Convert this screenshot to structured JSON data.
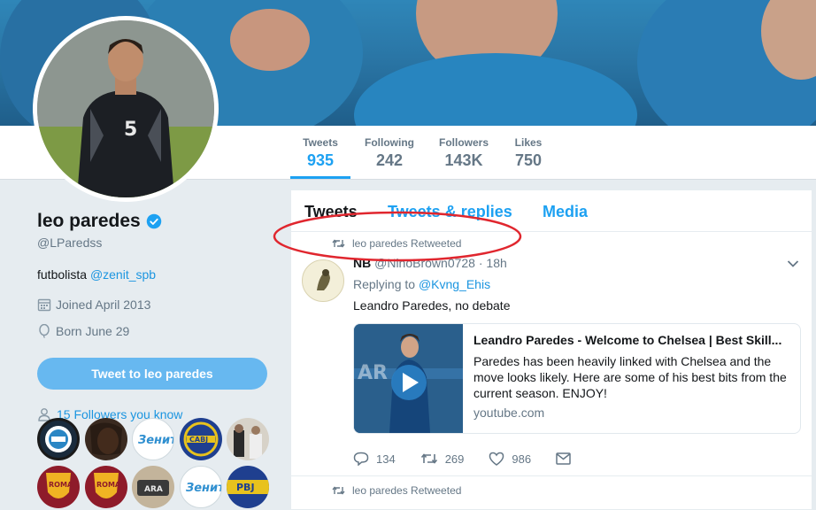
{
  "profile": {
    "name": "leo paredes",
    "handle": "@LParedss",
    "bio_prefix": "futbolista ",
    "bio_link": "@zenit_spb",
    "joined": "Joined April 2013",
    "born": "Born June 29",
    "tweet_to_label": "Tweet to leo paredes",
    "followers_you_know": "15 Followers you know"
  },
  "nav": {
    "stats": [
      {
        "label": "Tweets",
        "value": "935"
      },
      {
        "label": "Following",
        "value": "242"
      },
      {
        "label": "Followers",
        "value": "143K"
      },
      {
        "label": "Likes",
        "value": "750"
      }
    ]
  },
  "timeline": {
    "tabs": [
      "Tweets",
      "Tweets & replies",
      "Media"
    ],
    "retweet_label": "leo paredes Retweeted",
    "tweet": {
      "name": "NB",
      "handle": "@NinoBrown0728",
      "time": "· 18h",
      "replying_prefix": "Replying to ",
      "replying_to": "@Kvng_Ehis",
      "text": "Leandro Paredes, no debate",
      "card": {
        "title": "Leandro Paredes - Welcome to Chelsea | Best Skill...",
        "description": "Paredes has been heavily linked with Chelsea and the move looks likely. Here are some of his best bits from the current season. ENJOY!",
        "domain": "youtube.com"
      },
      "replies": "134",
      "retweets": "269",
      "likes": "986"
    },
    "second_retweet_label": "leo paredes Retweeted"
  },
  "colors": {
    "accent": "#1da1f2",
    "annotation": "#e0262e",
    "tweet_button": "#67b8f0"
  }
}
